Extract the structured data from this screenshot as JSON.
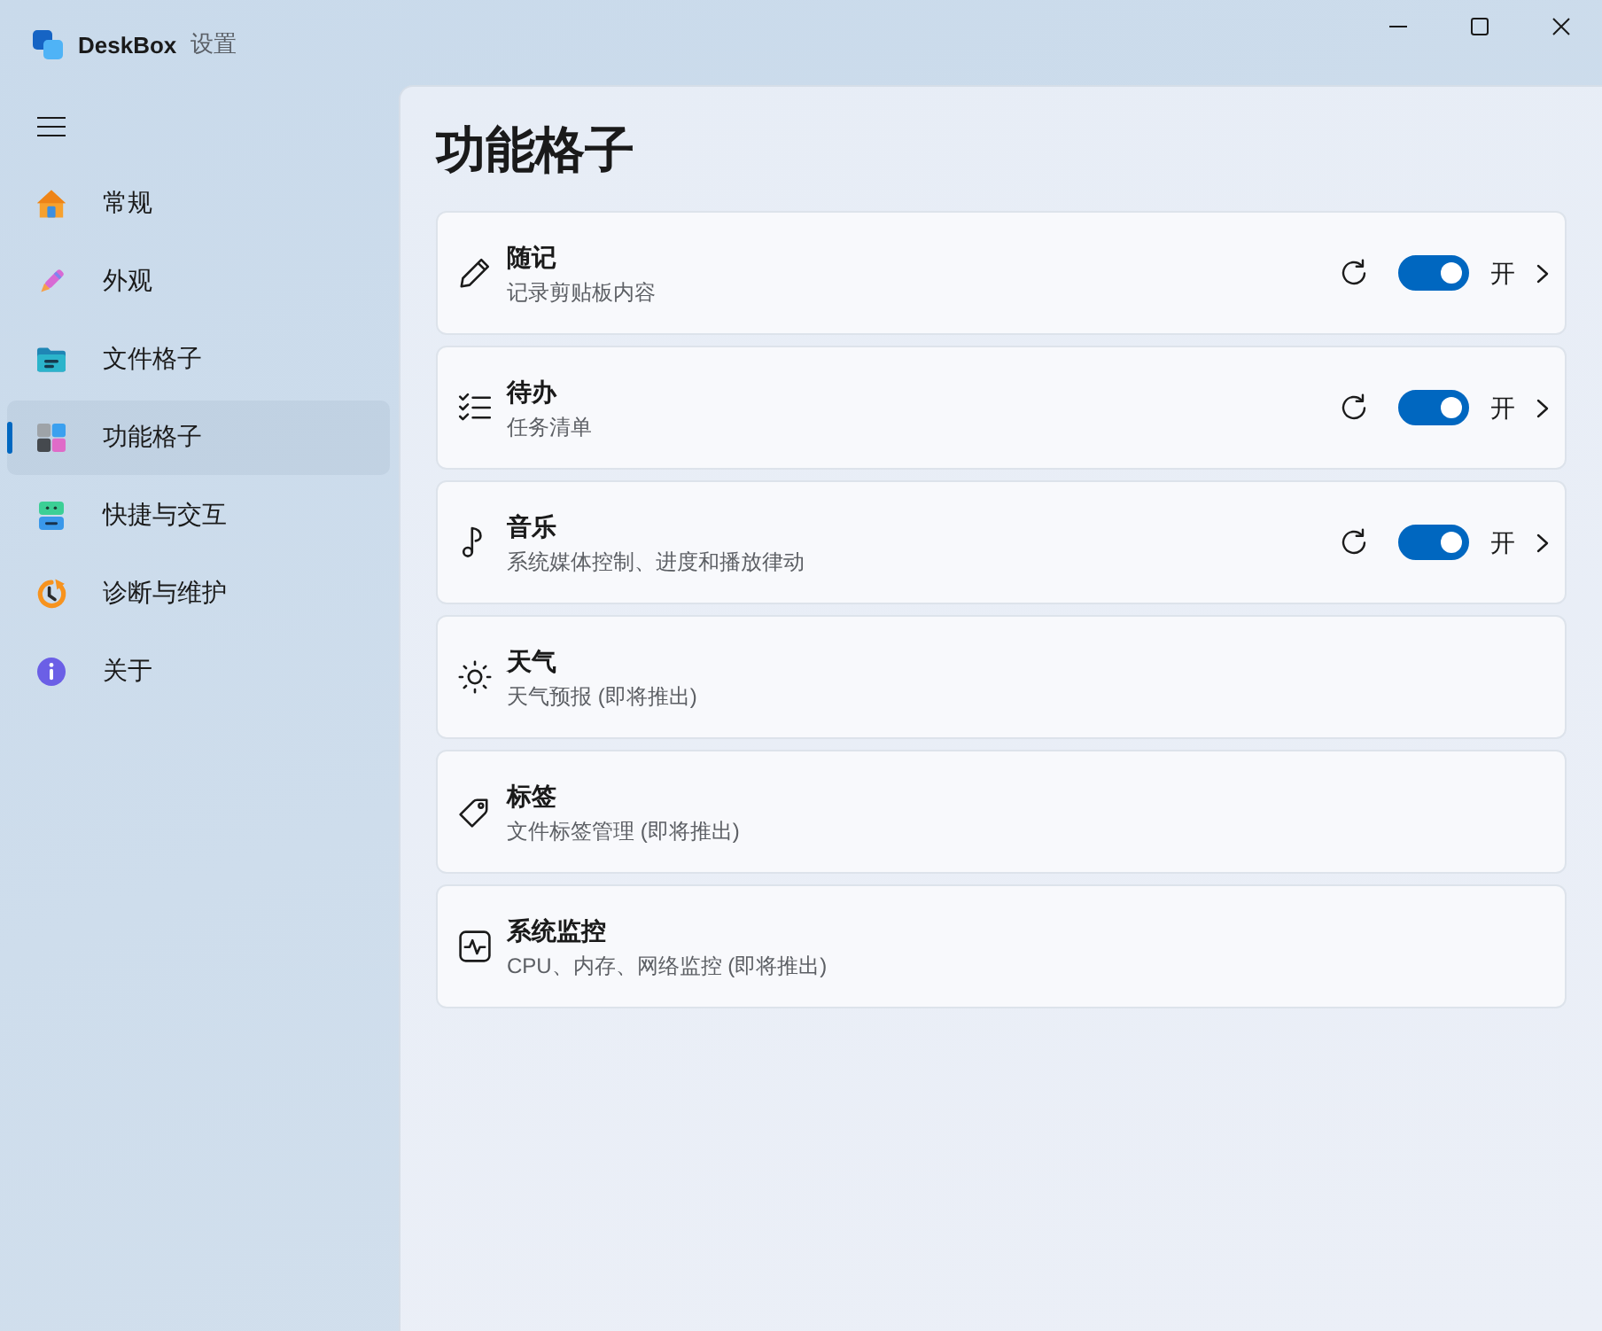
{
  "window": {
    "app_name": "DeskBox",
    "title": "设置"
  },
  "sidebar": {
    "items": [
      {
        "label": "常规",
        "selected": false
      },
      {
        "label": "外观",
        "selected": false
      },
      {
        "label": "文件格子",
        "selected": false
      },
      {
        "label": "功能格子",
        "selected": true
      },
      {
        "label": "快捷与交互",
        "selected": false
      },
      {
        "label": "诊断与维护",
        "selected": false
      },
      {
        "label": "关于",
        "selected": false
      }
    ]
  },
  "page": {
    "title": "功能格子"
  },
  "cards": [
    {
      "kind": "toggle",
      "title": "随记",
      "description": "记录剪贴板内容",
      "on": true,
      "state_label": "开"
    },
    {
      "kind": "toggle",
      "title": "待办",
      "description": "任务清单",
      "on": true,
      "state_label": "开"
    },
    {
      "kind": "toggle",
      "title": "音乐",
      "description": "系统媒体控制、进度和播放律动",
      "on": true,
      "state_label": "开"
    },
    {
      "kind": "plain",
      "title": "天气",
      "description": "天气预报 (即将推出)"
    },
    {
      "kind": "plain",
      "title": "标签",
      "description": "文件标签管理 (即将推出)"
    },
    {
      "kind": "plain",
      "title": "系统监控",
      "description": "CPU、内存、网络监控 (即将推出)"
    }
  ]
}
